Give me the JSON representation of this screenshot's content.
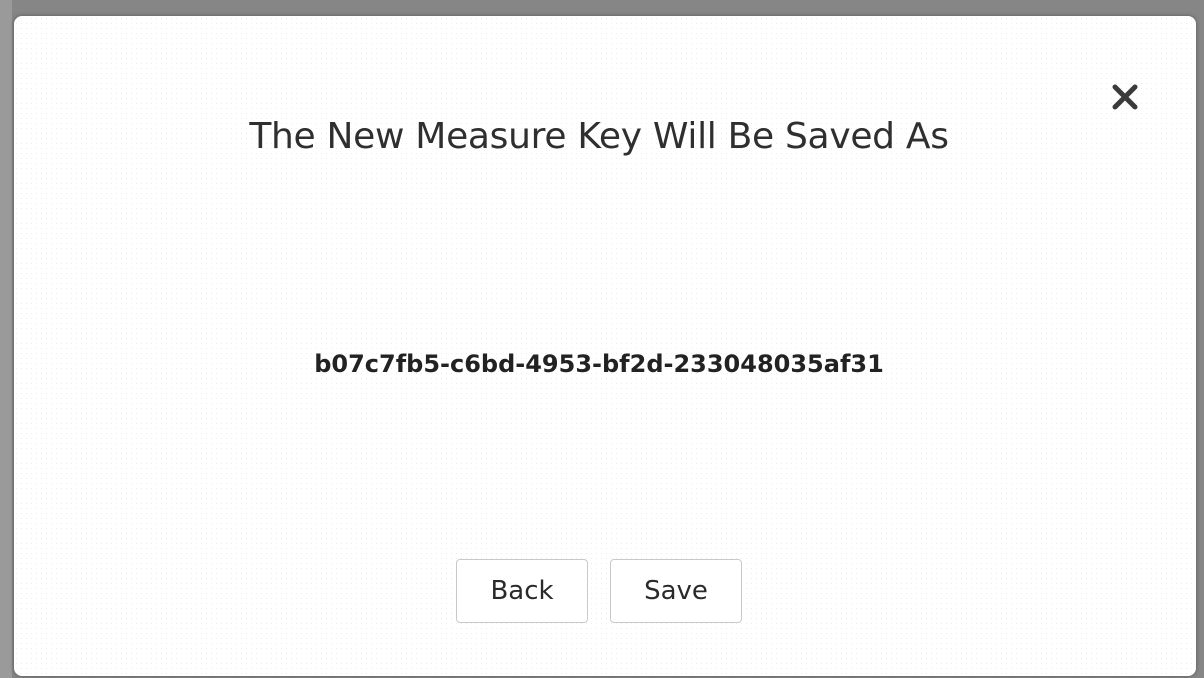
{
  "dialog": {
    "title": "The New Measure Key Will Be Saved As",
    "key_value": "b07c7fb5-c6bd-4953-bf2d-233048035af31",
    "back_label": "Back",
    "save_label": "Save",
    "close_icon": "close-icon"
  },
  "colors": {
    "overlay": "#868686",
    "modal_background": "#ffffff",
    "button_border": "#c9c9c9",
    "text": "#2f2f2f"
  }
}
